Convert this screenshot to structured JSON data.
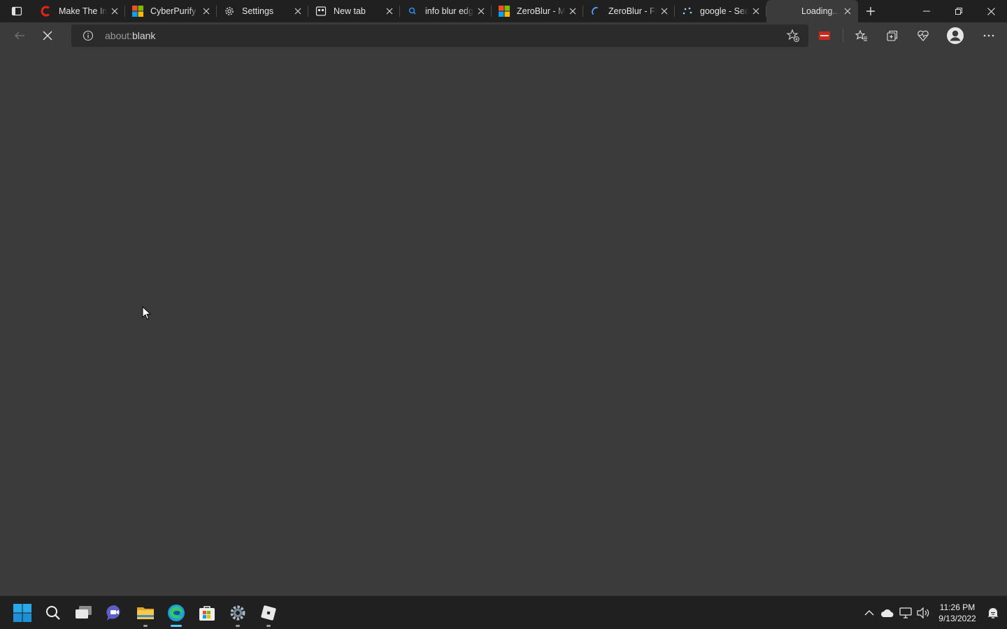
{
  "tabs": [
    {
      "title": "Make The Inter",
      "icon": "cisco-logo-icon"
    },
    {
      "title": "CyberPurify",
      "icon": "microsoft-logo-icon"
    },
    {
      "title": "Settings",
      "icon": "gear-icon"
    },
    {
      "title": "New tab",
      "icon": "newtab-icon"
    },
    {
      "title": "info blur edge",
      "icon": "bing-search-icon"
    },
    {
      "title": "ZeroBlur - Micr",
      "icon": "microsoft-logo-icon"
    },
    {
      "title": "ZeroBlur - Free",
      "icon": "loading-spinner-icon"
    },
    {
      "title": "google - Search",
      "icon": "loading-dots-icon"
    },
    {
      "title": "Loading...",
      "icon": "none",
      "active": true
    }
  ],
  "address": {
    "scheme": "about:",
    "path": "blank"
  },
  "clock": {
    "time": "11:26 PM",
    "date": "9/13/2022"
  },
  "colors": {
    "titlebar": "#202020",
    "content": "#3b3b3b",
    "accent": "#5cc8ff"
  }
}
